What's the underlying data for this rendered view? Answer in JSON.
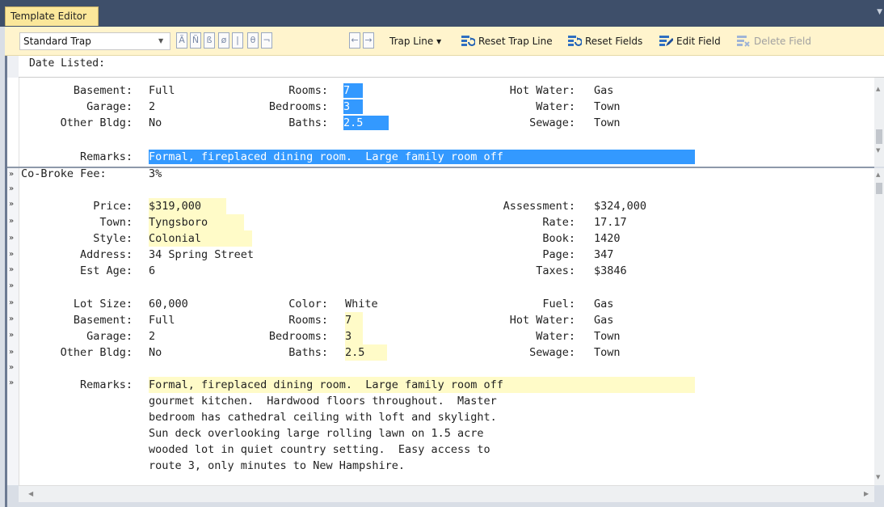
{
  "window": {
    "tab_title": "Template Editor"
  },
  "toolbar": {
    "template_select": "Standard Trap",
    "char_buttons": [
      "Ã",
      "Ñ",
      "ß",
      "ø",
      "|",
      "θ",
      "¬",
      "←",
      "→"
    ],
    "trap_line": "Trap Line ▾",
    "reset_trap_line": "Reset Trap Line",
    "reset_fields": "Reset Fields",
    "edit_field": "Edit Field",
    "delete_field": "Delete Field"
  },
  "header_strip": {
    "date_listed_label": "Date Listed:"
  },
  "markers": {
    "field_marker": "»"
  },
  "trap_pane": {
    "basement_label": "Basement:",
    "basement_value": "Full",
    "rooms_label": "Rooms:",
    "rooms_value": "7",
    "hot_water_label": "Hot Water:",
    "hot_water_value": "Gas",
    "garage_label": "Garage:",
    "garage_value": "2",
    "bedrooms_label": "Bedrooms:",
    "bedrooms_value": "3",
    "water_label": "Water:",
    "water_value": "Town",
    "other_bldg_label": "Other Bldg:",
    "other_bldg_value": "No",
    "baths_label": "Baths:",
    "baths_value": "2.5",
    "sewage_label": "Sewage:",
    "sewage_value": "Town",
    "remarks_label": "Remarks:",
    "remarks_value": "Formal, fireplaced dining room.  Large family room off"
  },
  "listing": {
    "cobroke_label": "Co-Broke Fee:",
    "cobroke_value": "3%",
    "price_label": "Price:",
    "price_value": "$319,000",
    "assessment_label": "Assessment:",
    "assessment_value": "$324,000",
    "town_label": "Town:",
    "town_value": "Tyngsboro",
    "rate_label": "Rate:",
    "rate_value": "17.17",
    "style_label": "Style:",
    "style_value": "Colonial",
    "book_label": "Book:",
    "book_value": "1420",
    "address_label": "Address:",
    "address_value": "34 Spring Street",
    "page_label": "Page:",
    "page_value": "347",
    "est_age_label": "Est Age:",
    "est_age_value": "6",
    "taxes_label": "Taxes:",
    "taxes_value": "$3846",
    "lot_size_label": "Lot Size:",
    "lot_size_value": "60,000",
    "color_label": "Color:",
    "color_value": "White",
    "fuel_label": "Fuel:",
    "fuel_value": "Gas",
    "basement_label": "Basement:",
    "basement_value": "Full",
    "rooms_label": "Rooms:",
    "rooms_value": "7",
    "hot_water_label": "Hot Water:",
    "hot_water_value": "Gas",
    "garage_label": "Garage:",
    "garage_value": "2",
    "bedrooms_label": "Bedrooms:",
    "bedrooms_value": "3",
    "water_label": "Water:",
    "water_value": "Town",
    "other_bldg_label": "Other Bldg:",
    "other_bldg_value": "No",
    "baths_label": "Baths:",
    "baths_value": "2.5",
    "sewage_label": "Sewage:",
    "sewage_value": "Town",
    "remarks_label": "Remarks:",
    "remarks_lines": [
      "Formal, fireplaced dining room.  Large family room off",
      "gourmet kitchen.  Hardwood floors throughout.  Master",
      "bedroom has cathedral ceiling with loft and skylight.",
      "Sun deck overlooking large rolling lawn on 1.5 acre",
      "wooded lot in quiet country setting.  Easy access to",
      "route 3, only minutes to New Hampshire."
    ]
  },
  "colors": {
    "selection": "#3399ff",
    "field_highlight": "#fffbc8",
    "toolbar_bg": "#fff4cd",
    "titlebar": "#3e4f6a"
  }
}
